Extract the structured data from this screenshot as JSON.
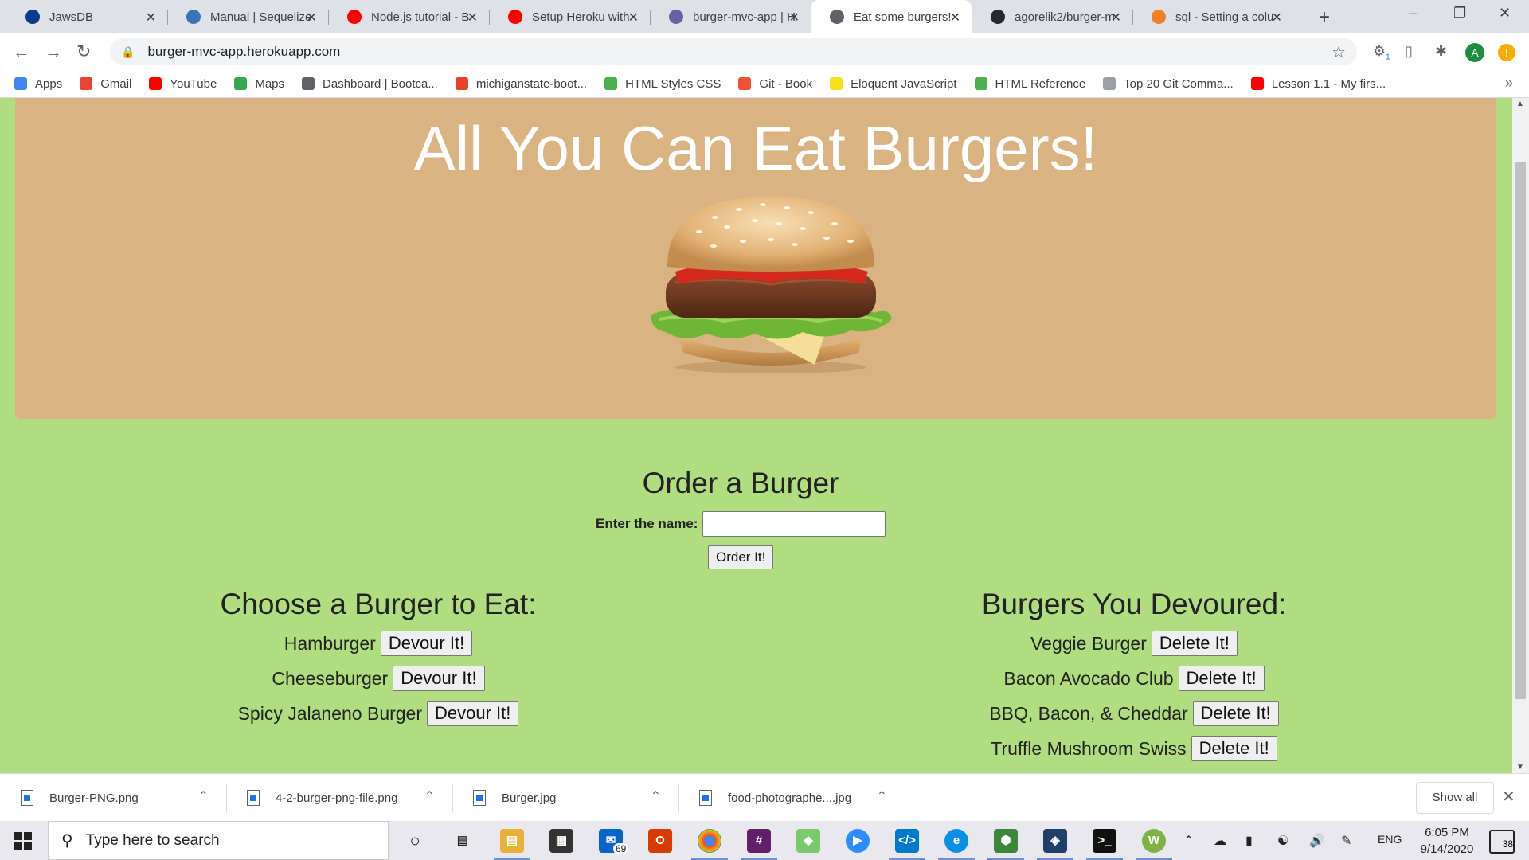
{
  "browser": {
    "tabs": [
      {
        "title": "JawsDB",
        "color": "#0b3c8c"
      },
      {
        "title": "Manual | Sequelize",
        "color": "#3b73b9"
      },
      {
        "title": "Node.js tutorial - B",
        "color": "#ff0000"
      },
      {
        "title": "Setup Heroku with",
        "color": "#ff0000"
      },
      {
        "title": "burger-mvc-app | H",
        "color": "#6762a6"
      },
      {
        "title": "Eat some burgers!",
        "color": "#5f6368"
      },
      {
        "title": "agorelik2/burger-m",
        "color": "#24292e"
      },
      {
        "title": "sql - Setting a colu",
        "color": "#f48024"
      }
    ],
    "active_tab_index": 5,
    "url": "burger-mvc-app.herokuapp.com",
    "profile_initial": "A",
    "extension_badge": "1",
    "update_badge": "!"
  },
  "bookmarks": [
    {
      "label": "Apps",
      "color": "#4285f4"
    },
    {
      "label": "Gmail",
      "color": "#ea4335"
    },
    {
      "label": "YouTube",
      "color": "#ff0000"
    },
    {
      "label": "Maps",
      "color": "#34a853"
    },
    {
      "label": "Dashboard | Bootca...",
      "color": "#5f6368"
    },
    {
      "label": "michiganstate-boot...",
      "color": "#e24329"
    },
    {
      "label": "HTML Styles CSS",
      "color": "#4caf50"
    },
    {
      "label": "Git - Book",
      "color": "#f05133"
    },
    {
      "label": "Eloquent JavaScript",
      "color": "#f7df1e"
    },
    {
      "label": "HTML Reference",
      "color": "#4caf50"
    },
    {
      "label": "Top 20 Git Comma...",
      "color": "#9aa0a6"
    },
    {
      "label": "Lesson 1.1 - My firs...",
      "color": "#ff0000"
    }
  ],
  "page": {
    "title": "All You Can Eat Burgers!",
    "order_heading": "Order a Burger",
    "name_label": "Enter the name:",
    "name_value": "",
    "order_button": "Order It!",
    "eat_heading": "Choose a Burger to Eat:",
    "devoured_heading": "Burgers You Devoured:",
    "devour_button": "Devour It!",
    "delete_button": "Delete It!",
    "to_eat": [
      "Hamburger",
      "Cheeseburger",
      "Spicy Jalaneno Burger"
    ],
    "devoured": [
      "Veggie Burger",
      "Bacon Avocado Club",
      "BBQ, Bacon, & Cheddar",
      "Truffle Mushroom Swiss"
    ],
    "colors": {
      "background": "#b0dd80",
      "jumbotron": "#d9b381",
      "title_text": "#ffffff"
    }
  },
  "downloads": {
    "files": [
      "Burger-PNG.png",
      "4-2-burger-png-file.png",
      "Burger.jpg",
      "food-photographe....jpg"
    ],
    "show_all": "Show all"
  },
  "taskbar": {
    "search_placeholder": "Type here to search",
    "mail_badge": "69",
    "language": "ENG",
    "time": "6:05 PM",
    "date": "9/14/2020",
    "notification_count": "38"
  }
}
